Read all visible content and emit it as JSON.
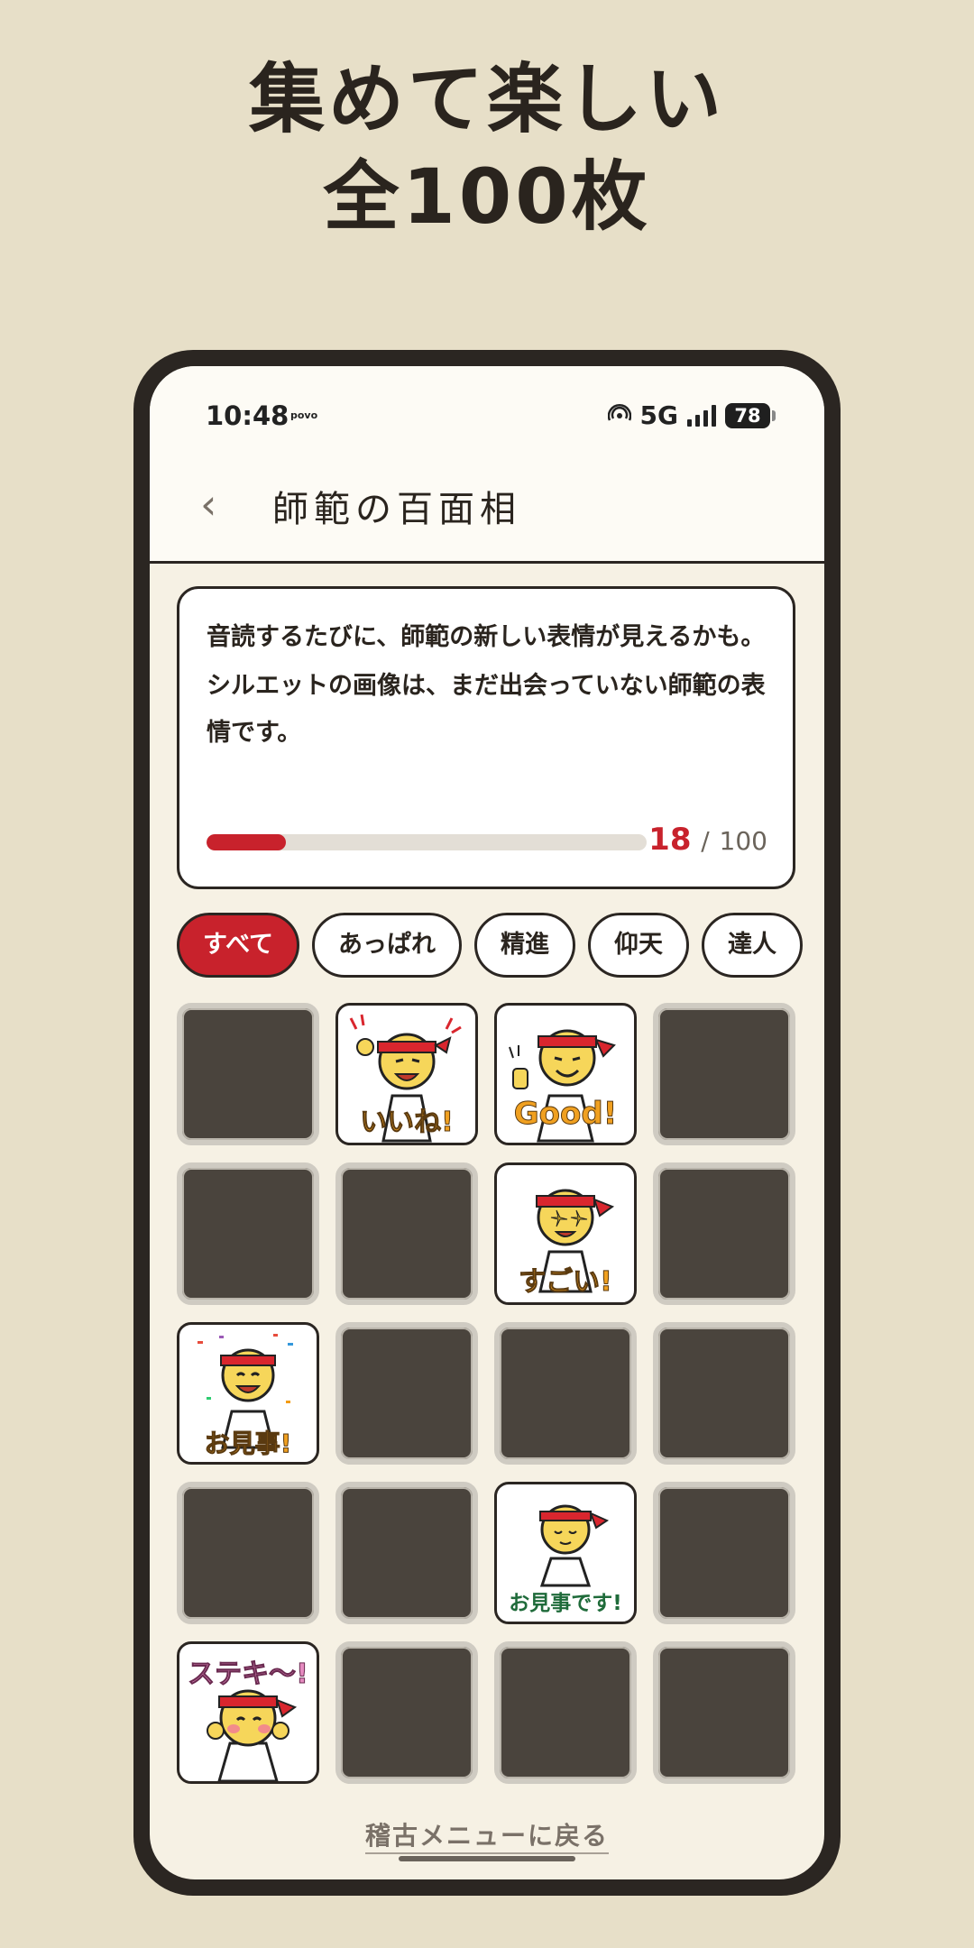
{
  "promo": {
    "line1": "集めて楽しい",
    "line2": "全100枚"
  },
  "status_bar": {
    "time": "10:48",
    "carrier": "povo",
    "network": "5G",
    "battery": "78"
  },
  "header": {
    "back_label": "‹",
    "title": "師範の百面相"
  },
  "info": {
    "para1": "音読するたびに、師範の新しい表情が見えるかも。",
    "para2": "シルエットの画像は、まだ出会っていない師範の表情です。",
    "progress": {
      "collected": "18",
      "separator": "/",
      "total": "100",
      "fraction": 0.18
    }
  },
  "filters": [
    "すべて",
    "あっぱれ",
    "精進",
    "仰天",
    "達人"
  ],
  "active_filter": 0,
  "stickers": {
    "iine": "いいね!",
    "good": "Good!",
    "sugoi": "すごい!",
    "omigoto": "お見事!",
    "omigotodesu": "お見事です!",
    "suteki": "ステキ〜!"
  },
  "footer": {
    "back_menu": "稽古メニューに戻る"
  },
  "colors": {
    "accent": "#C8222C",
    "background": "#E7DFC8",
    "locked": "#4A443D"
  }
}
